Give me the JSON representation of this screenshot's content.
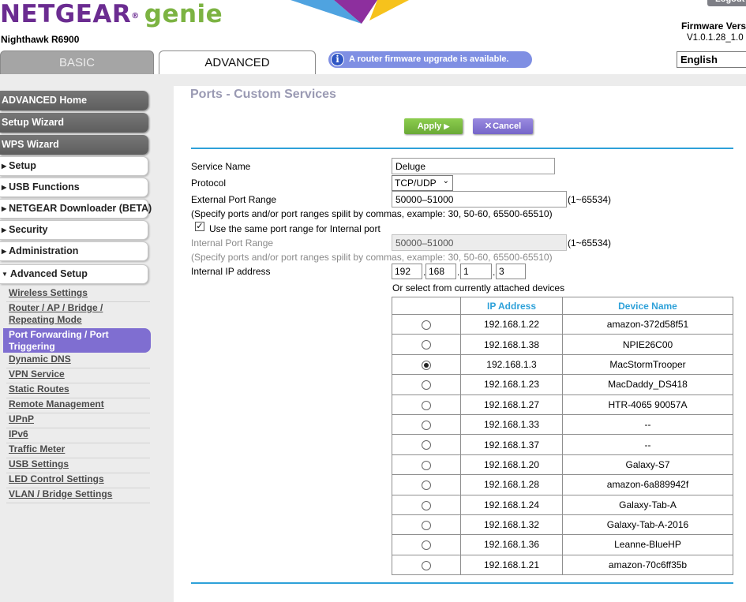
{
  "header": {
    "brand": "NETGEAR",
    "reg_mark": "®",
    "product": "genie",
    "model": "Nighthawk R6900",
    "logout_label": "Logout",
    "firmware_label": "Firmware Vers",
    "firmware_value": "V1.0.1.28_1.0",
    "language": "English"
  },
  "tabs": [
    {
      "label": "BASIC",
      "active": false
    },
    {
      "label": "ADVANCED",
      "active": true
    }
  ],
  "upgrade_notice": "A router firmware upgrade is available.",
  "sidebar": {
    "dark_items": [
      "ADVANCED Home",
      "Setup Wizard",
      "WPS Wizard"
    ],
    "sections": [
      "Setup",
      "USB Functions",
      "NETGEAR Downloader (BETA)",
      "Security",
      "Administration"
    ],
    "expanded_section": "Advanced Setup",
    "sub_items_before": [
      "Wireless Settings",
      "Router / AP / Bridge /",
      "Repeating Mode"
    ],
    "active_item_line1": "Port Forwarding / Port",
    "active_item_line2": "Triggering",
    "sub_items_after": [
      "Dynamic DNS",
      "VPN Service",
      "Static Routes",
      "Remote Management",
      "UPnP",
      "IPv6",
      "Traffic Meter",
      "USB Settings",
      "LED Control Settings",
      "VLAN / Bridge Settings"
    ]
  },
  "main": {
    "title": "Ports - Custom Services",
    "apply_label": "Apply",
    "apply_arrow": "▶",
    "cancel_icon": "✕",
    "cancel_label": "Cancel",
    "form": {
      "service_name_label": "Service Name",
      "service_name_value": "Deluge",
      "protocol_label": "Protocol",
      "protocol_value": "TCP/UDP",
      "external_port_label": "External Port Range",
      "external_port_value": "50000–51000",
      "range_hint": "(1~65534)",
      "help_text": "(Specify ports and/or port ranges spilit by commas, example: 30, 50-60, 65500-65510)",
      "same_range_checked": true,
      "same_range_label": "Use the same port range for Internal port",
      "internal_port_label": "Internal Port Range",
      "internal_port_value": "50000–51000",
      "internal_ip_label": "Internal IP address",
      "ip": [
        "192",
        "168",
        "1",
        "3"
      ],
      "select_text": "Or select from currently attached devices"
    },
    "table": {
      "headers": [
        "",
        "IP Address",
        "Device Name"
      ],
      "rows": [
        {
          "selected": false,
          "ip": "192.168.1.22",
          "name": "amazon-372d58f51"
        },
        {
          "selected": false,
          "ip": "192.168.1.38",
          "name": "NPIE26C00"
        },
        {
          "selected": true,
          "ip": "192.168.1.3",
          "name": "MacStormTrooper"
        },
        {
          "selected": false,
          "ip": "192.168.1.23",
          "name": "MacDaddy_DS418"
        },
        {
          "selected": false,
          "ip": "192.168.1.27",
          "name": "HTR-4065 90057A"
        },
        {
          "selected": false,
          "ip": "192.168.1.33",
          "name": "--"
        },
        {
          "selected": false,
          "ip": "192.168.1.37",
          "name": "--"
        },
        {
          "selected": false,
          "ip": "192.168.1.20",
          "name": "Galaxy-S7"
        },
        {
          "selected": false,
          "ip": "192.168.1.28",
          "name": "amazon-6a889942f"
        },
        {
          "selected": false,
          "ip": "192.168.1.24",
          "name": "Galaxy-Tab-A"
        },
        {
          "selected": false,
          "ip": "192.168.1.32",
          "name": "Galaxy-Tab-A-2016"
        },
        {
          "selected": false,
          "ip": "192.168.1.36",
          "name": "Leanne-BlueHP"
        },
        {
          "selected": false,
          "ip": "192.168.1.21",
          "name": "amazon-70c6ff35b"
        }
      ]
    }
  }
}
